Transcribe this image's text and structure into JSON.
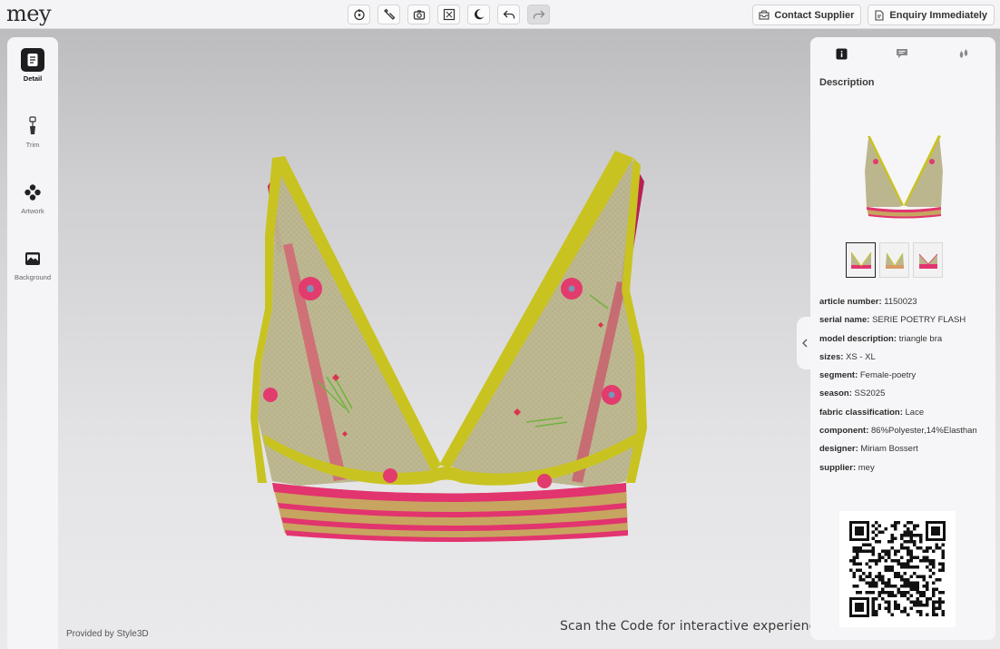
{
  "brand": {
    "logo_text": "mey"
  },
  "toolbar": {
    "buttons": [
      {
        "icon": "rotate-icon"
      },
      {
        "icon": "wrench-icon"
      },
      {
        "icon": "camera-icon"
      },
      {
        "icon": "fullscreen-icon"
      },
      {
        "icon": "moon-icon"
      },
      {
        "icon": "undo-icon"
      },
      {
        "icon": "redo-icon",
        "disabled": true
      }
    ]
  },
  "actions": {
    "contact_supplier": "Contact Supplier",
    "enquiry": "Enquiry Immediately"
  },
  "sidebar": {
    "items": [
      {
        "label": "Detail",
        "icon": "document-icon",
        "active": true
      },
      {
        "label": "Trim",
        "icon": "zipper-icon",
        "active": false
      },
      {
        "label": "Artwork",
        "icon": "flower-icon",
        "active": false
      },
      {
        "label": "Background",
        "icon": "image-icon",
        "active": false
      }
    ]
  },
  "viewer": {
    "provided_by": "Provided by Style3D",
    "scan_text": "Scan the Code for interactive experience"
  },
  "panel": {
    "tabs": [
      {
        "icon": "info-icon",
        "active": true
      },
      {
        "icon": "comment-icon",
        "active": false
      },
      {
        "icon": "drops-icon",
        "active": false
      }
    ],
    "title": "Description",
    "details": [
      {
        "key": "article number:",
        "value": "1150023"
      },
      {
        "key": "serial name:",
        "value": "SERIE POETRY FLASH"
      },
      {
        "key": "model description:",
        "value": "triangle bra"
      },
      {
        "key": "sizes:",
        "value": "XS - XL"
      },
      {
        "key": "segment:",
        "value": "Female-poetry"
      },
      {
        "key": "season:",
        "value": "SS2025"
      },
      {
        "key": "fabric classification:",
        "value": "Lace"
      },
      {
        "key": "component:",
        "value": "86%Polyester,14%Elasthan"
      },
      {
        "key": "designer:",
        "value": "Miriam Bossert"
      },
      {
        "key": "supplier:",
        "value": "mey"
      }
    ]
  },
  "colors": {
    "trim_yellow": "#c8c21e",
    "band_pink": "#e2346e",
    "mesh": "#bdb88a",
    "accent_dark": "#1d1d1f"
  }
}
